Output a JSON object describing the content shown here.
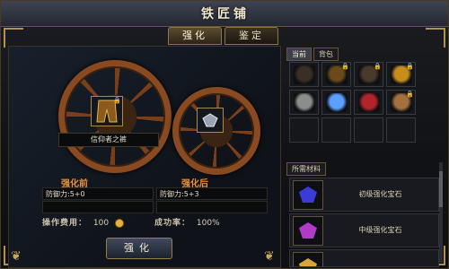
{
  "window": {
    "title": "铁匠铺"
  },
  "tabs": [
    {
      "label": "强化",
      "active": true
    },
    {
      "label": "鉴定",
      "active": false
    }
  ],
  "enhance": {
    "item_name": "信仰者之裤",
    "before_label": "强化前",
    "after_label": "强化后",
    "before_stat": "防御力:5+0",
    "after_stat": "防御力:5+3",
    "cost_label": "操作费用：",
    "cost_value": "100",
    "rate_label": "成功率：",
    "rate_value": "100%",
    "button_label": "强化"
  },
  "inventory": {
    "tabs": [
      {
        "label": "当前",
        "active": true
      },
      {
        "label": "背包",
        "active": false
      }
    ],
    "slots": [
      {
        "icon": "bracer-icon",
        "color": "#3a2f24",
        "locked": false
      },
      {
        "icon": "pants-icon",
        "color": "#6a4a18",
        "locked": true
      },
      {
        "icon": "belt-icon",
        "color": "#4a3a2c",
        "locked": true
      },
      {
        "icon": "robe-icon",
        "color": "#c78d1d",
        "locked": true
      },
      {
        "icon": "orb-icon",
        "color": "#8c8c8c",
        "locked": false
      },
      {
        "icon": "rune-icon",
        "color": "#5aa0ff",
        "locked": false
      },
      {
        "icon": "armor-icon",
        "color": "#b0242a",
        "locked": false
      },
      {
        "icon": "staff-icon",
        "color": "#a47040",
        "locked": true
      },
      {
        "icon": "",
        "color": "",
        "locked": false
      },
      {
        "icon": "",
        "color": "",
        "locked": false
      },
      {
        "icon": "",
        "color": "",
        "locked": false
      },
      {
        "icon": "",
        "color": "",
        "locked": false
      }
    ]
  },
  "materials": {
    "label": "所需材料",
    "items": [
      {
        "name": "初级强化宝石",
        "color": "#3b3bd8"
      },
      {
        "name": "中级强化宝石",
        "color": "#b13ac6"
      },
      {
        "name": "",
        "color": "#d6a63a"
      }
    ]
  }
}
